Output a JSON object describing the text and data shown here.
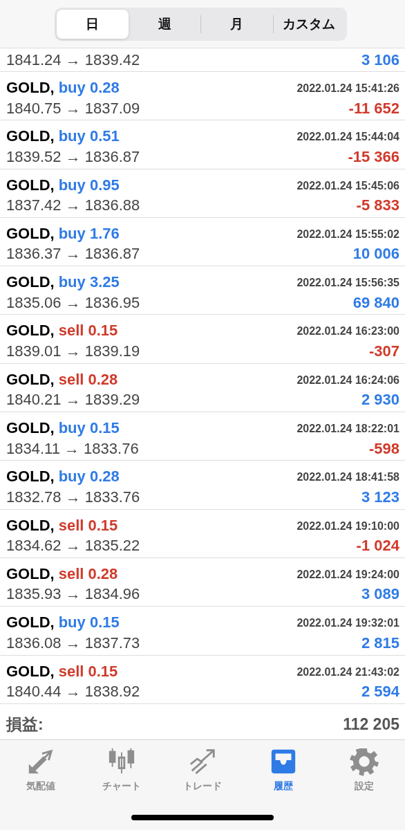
{
  "period_tabs": [
    {
      "label": "日",
      "selected": true
    },
    {
      "label": "週",
      "selected": false
    },
    {
      "label": "月",
      "selected": false
    },
    {
      "label": "カスタム",
      "selected": false
    }
  ],
  "partial_row": {
    "prices": "1841.24 → 1839.42",
    "profit": {
      "text": "3 106",
      "kind": "gain"
    }
  },
  "trades": [
    {
      "symbol": "GOLD,",
      "order": {
        "text": "buy 0.28",
        "kind": "buy"
      },
      "time": "2022.01.24 15:41:26",
      "prices": "1840.75 → 1837.09",
      "profit": {
        "text": "-11 652",
        "kind": "loss"
      }
    },
    {
      "symbol": "GOLD,",
      "order": {
        "text": "buy 0.51",
        "kind": "buy"
      },
      "time": "2022.01.24 15:44:04",
      "prices": "1839.52 → 1836.87",
      "profit": {
        "text": "-15 366",
        "kind": "loss"
      }
    },
    {
      "symbol": "GOLD,",
      "order": {
        "text": "buy 0.95",
        "kind": "buy"
      },
      "time": "2022.01.24 15:45:06",
      "prices": "1837.42 → 1836.88",
      "profit": {
        "text": "-5 833",
        "kind": "loss"
      }
    },
    {
      "symbol": "GOLD,",
      "order": {
        "text": "buy 1.76",
        "kind": "buy"
      },
      "time": "2022.01.24 15:55:02",
      "prices": "1836.37 → 1836.87",
      "profit": {
        "text": "10 006",
        "kind": "gain"
      }
    },
    {
      "symbol": "GOLD,",
      "order": {
        "text": "buy 3.25",
        "kind": "buy"
      },
      "time": "2022.01.24 15:56:35",
      "prices": "1835.06 → 1836.95",
      "profit": {
        "text": "69 840",
        "kind": "gain"
      }
    },
    {
      "symbol": "GOLD,",
      "order": {
        "text": "sell 0.15",
        "kind": "sell"
      },
      "time": "2022.01.24 16:23:00",
      "prices": "1839.01 → 1839.19",
      "profit": {
        "text": "-307",
        "kind": "loss"
      }
    },
    {
      "symbol": "GOLD,",
      "order": {
        "text": "sell 0.28",
        "kind": "sell"
      },
      "time": "2022.01.24 16:24:06",
      "prices": "1840.21 → 1839.29",
      "profit": {
        "text": "2 930",
        "kind": "gain"
      }
    },
    {
      "symbol": "GOLD,",
      "order": {
        "text": "buy 0.15",
        "kind": "buy"
      },
      "time": "2022.01.24 18:22:01",
      "prices": "1834.11 → 1833.76",
      "profit": {
        "text": "-598",
        "kind": "loss"
      }
    },
    {
      "symbol": "GOLD,",
      "order": {
        "text": "buy 0.28",
        "kind": "buy"
      },
      "time": "2022.01.24 18:41:58",
      "prices": "1832.78 → 1833.76",
      "profit": {
        "text": "3 123",
        "kind": "gain"
      }
    },
    {
      "symbol": "GOLD,",
      "order": {
        "text": "sell 0.15",
        "kind": "sell"
      },
      "time": "2022.01.24 19:10:00",
      "prices": "1834.62 → 1835.22",
      "profit": {
        "text": "-1 024",
        "kind": "loss"
      }
    },
    {
      "symbol": "GOLD,",
      "order": {
        "text": "sell 0.28",
        "kind": "sell"
      },
      "time": "2022.01.24 19:24:00",
      "prices": "1835.93 → 1834.96",
      "profit": {
        "text": "3 089",
        "kind": "gain"
      }
    },
    {
      "symbol": "GOLD,",
      "order": {
        "text": "buy 0.15",
        "kind": "buy"
      },
      "time": "2022.01.24 19:32:01",
      "prices": "1836.08 → 1837.73",
      "profit": {
        "text": "2 815",
        "kind": "gain"
      }
    },
    {
      "symbol": "GOLD,",
      "order": {
        "text": "sell 0.15",
        "kind": "sell"
      },
      "time": "2022.01.24 21:43:02",
      "prices": "1840.44 → 1838.92",
      "profit": {
        "text": "2 594",
        "kind": "gain"
      }
    }
  ],
  "summary": {
    "label": "損益:",
    "value": "112 205"
  },
  "tab_bar": [
    {
      "label": "気配値",
      "selected": false
    },
    {
      "label": "チャート",
      "selected": false
    },
    {
      "label": "トレード",
      "selected": false
    },
    {
      "label": "履歴",
      "selected": true
    },
    {
      "label": "設定",
      "selected": false
    }
  ]
}
